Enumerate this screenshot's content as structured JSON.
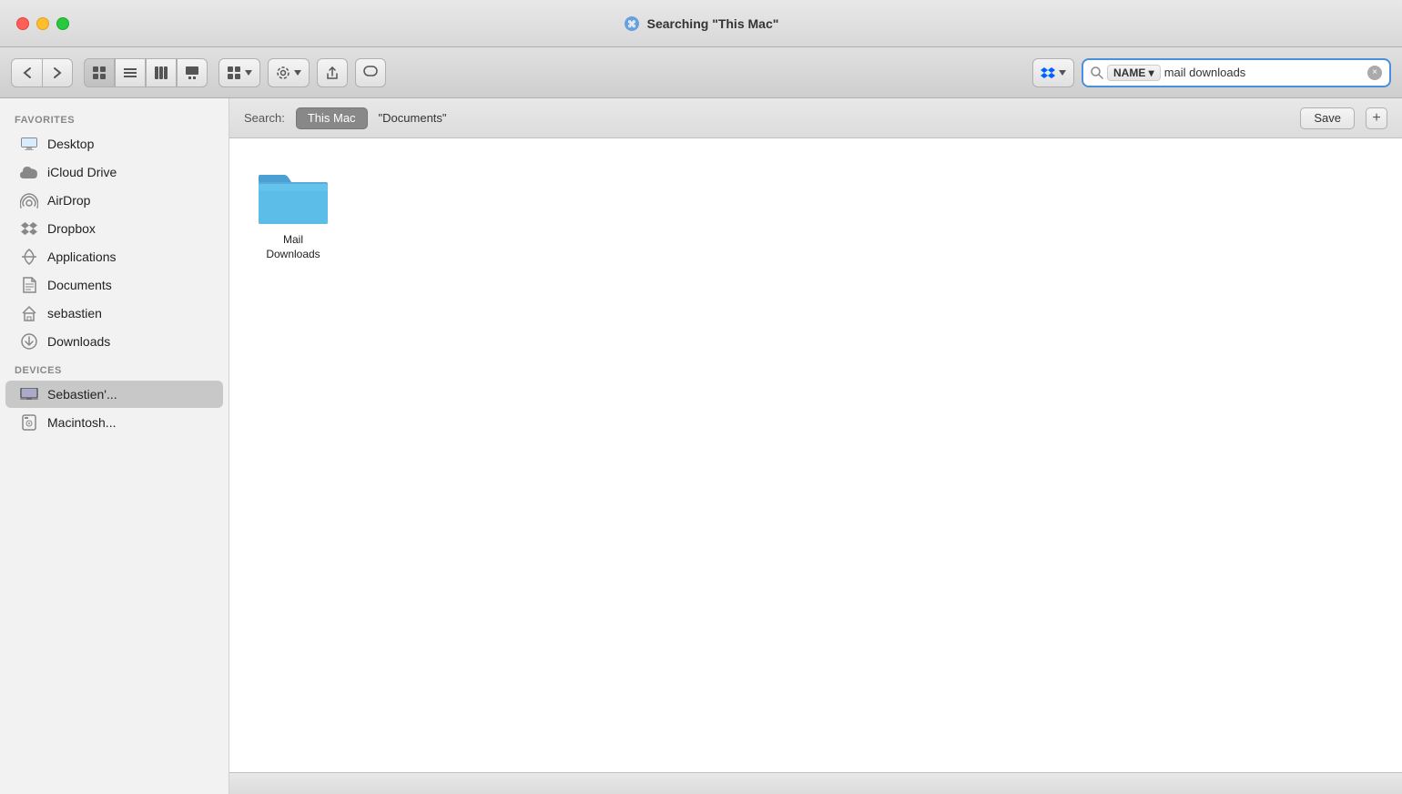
{
  "titleBar": {
    "title": "Searching \"This Mac\"",
    "titleIcon": "🔍"
  },
  "toolbar": {
    "backLabel": "‹",
    "forwardLabel": "›",
    "viewIconGrid": "▦",
    "viewIconList": "☰",
    "viewIconColumns": "⊞",
    "viewIconCover": "⊟",
    "viewIconGroupDropdown": "▦▾",
    "settingsLabel": "⚙",
    "shareLabel": "⎙",
    "tagLabel": "◯",
    "dropboxLabel": "Dropbox ▾",
    "searchPlaceholder": "",
    "searchValue": "mail downloads",
    "searchNameBadge": "NAME ▾",
    "searchCloseLabel": "×"
  },
  "searchScope": {
    "label": "Search:",
    "thisMacBtn": "This Mac",
    "documentsBtn": "\"Documents\"",
    "saveBtn": "Save",
    "addBtn": "+"
  },
  "sidebar": {
    "favoritesLabel": "Favorites",
    "devicesLabel": "Devices",
    "items": [
      {
        "id": "desktop",
        "label": "Desktop",
        "icon": "desktop"
      },
      {
        "id": "icloud",
        "label": "iCloud Drive",
        "icon": "icloud"
      },
      {
        "id": "airdrop",
        "label": "AirDrop",
        "icon": "airdrop"
      },
      {
        "id": "dropbox",
        "label": "Dropbox",
        "icon": "dropbox"
      },
      {
        "id": "applications",
        "label": "Applications",
        "icon": "applications"
      },
      {
        "id": "documents",
        "label": "Documents",
        "icon": "documents"
      },
      {
        "id": "sebastien",
        "label": "sebastien",
        "icon": "home"
      },
      {
        "id": "downloads",
        "label": "Downloads",
        "icon": "downloads"
      }
    ],
    "deviceItems": [
      {
        "id": "sebastien-mac",
        "label": "Sebastien'...",
        "icon": "laptop",
        "active": true
      },
      {
        "id": "macintosh-hd",
        "label": "Macintosh...",
        "icon": "harddisk"
      }
    ]
  },
  "fileArea": {
    "files": [
      {
        "id": "mail-downloads",
        "name": "Mail Downloads",
        "type": "folder"
      }
    ]
  }
}
